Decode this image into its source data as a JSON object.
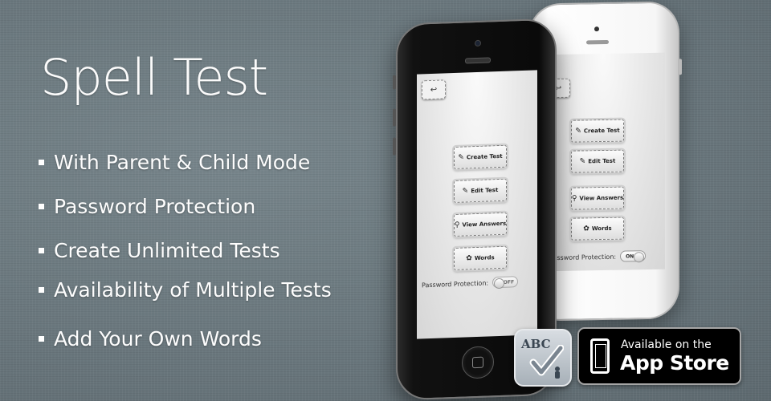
{
  "title": "Spell Test",
  "features": [
    "With Parent & Child Mode",
    "Password Protection",
    "Create Unlimited Tests",
    "Availability of Multiple Tests",
    "Add Your Own Words"
  ],
  "phone_screen": {
    "back_icon": "back-arrow-icon",
    "menu": [
      {
        "label": "Create Test",
        "icon": "pencil-paper-icon"
      },
      {
        "label": "Edit Test",
        "icon": "pencil-icon"
      },
      {
        "label": "View Answers",
        "icon": "magnifier-icon"
      },
      {
        "label": "Words",
        "icon": "puzzle-icon"
      }
    ],
    "password_label": "Password Protection:"
  },
  "toggle_black_phone": "OFF",
  "toggle_white_phone": "ON",
  "app_icon": {
    "text": "ABC"
  },
  "appstore_badge": {
    "line1": "Available on the",
    "line2": "App Store"
  },
  "colors": {
    "background": "#6d7a80",
    "text": "#ffffff"
  }
}
